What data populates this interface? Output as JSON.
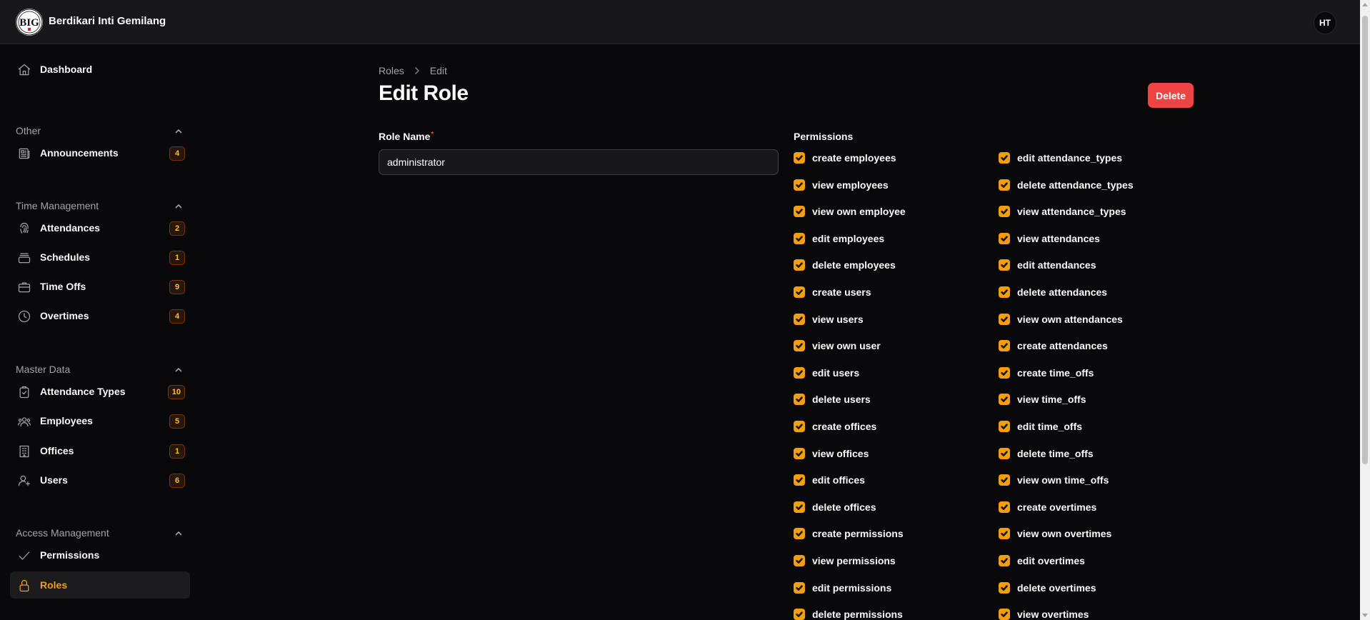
{
  "app": {
    "brand_name": "Berdikari Inti Gemilang",
    "logo_text": "BIG",
    "user_initials": "HT"
  },
  "sidebar": {
    "dashboard": {
      "label": "Dashboard",
      "icon": "home-icon"
    },
    "groups": [
      {
        "label": "Other",
        "items": [
          {
            "label": "Announcements",
            "badge": "4",
            "icon": "newspaper-icon"
          }
        ]
      },
      {
        "label": "Time Management",
        "items": [
          {
            "label": "Attendances",
            "badge": "2",
            "icon": "fingerprint-icon"
          },
          {
            "label": "Schedules",
            "badge": "1",
            "icon": "archive-icon"
          },
          {
            "label": "Time Offs",
            "badge": "9",
            "icon": "briefcase-icon"
          },
          {
            "label": "Overtimes",
            "badge": "4",
            "icon": "clock-icon"
          }
        ]
      },
      {
        "label": "Master Data",
        "items": [
          {
            "label": "Attendance Types",
            "badge": "10",
            "icon": "clipboard-check-icon"
          },
          {
            "label": "Employees",
            "badge": "5",
            "icon": "users-group-icon"
          },
          {
            "label": "Offices",
            "badge": "1",
            "icon": "building-icon"
          },
          {
            "label": "Users",
            "badge": "6",
            "icon": "user-plus-icon"
          }
        ]
      },
      {
        "label": "Access Management",
        "items": [
          {
            "label": "Permissions",
            "icon": "check-icon"
          },
          {
            "label": "Roles",
            "icon": "lock-icon",
            "active": true
          }
        ]
      }
    ]
  },
  "breadcrumb": {
    "parent": "Roles",
    "current": "Edit"
  },
  "page": {
    "title": "Edit Role",
    "delete_label": "Delete"
  },
  "form": {
    "role_name_label": "Role Name",
    "required_mark": "*",
    "role_name_value": "administrator",
    "permissions_label": "Permissions"
  },
  "permissions": {
    "column1": [
      "create employees",
      "view employees",
      "view own employee",
      "edit employees",
      "delete employees",
      "create users",
      "view users",
      "view own user",
      "edit users",
      "delete users",
      "create offices",
      "view offices",
      "edit offices",
      "delete offices",
      "create permissions",
      "view permissions",
      "edit permissions",
      "delete permissions"
    ],
    "column2": [
      "edit attendance_types",
      "delete attendance_types",
      "view attendance_types",
      "view attendances",
      "edit attendances",
      "delete attendances",
      "view own attendances",
      "create attendances",
      "create time_offs",
      "view time_offs",
      "edit time_offs",
      "delete time_offs",
      "view own time_offs",
      "create overtimes",
      "view own overtimes",
      "edit overtimes",
      "delete overtimes",
      "view overtimes"
    ],
    "checked": true
  },
  "colors": {
    "accent": "#f59e0b",
    "danger": "#ef4444",
    "background": "#09090b",
    "topbar": "#18181b"
  }
}
